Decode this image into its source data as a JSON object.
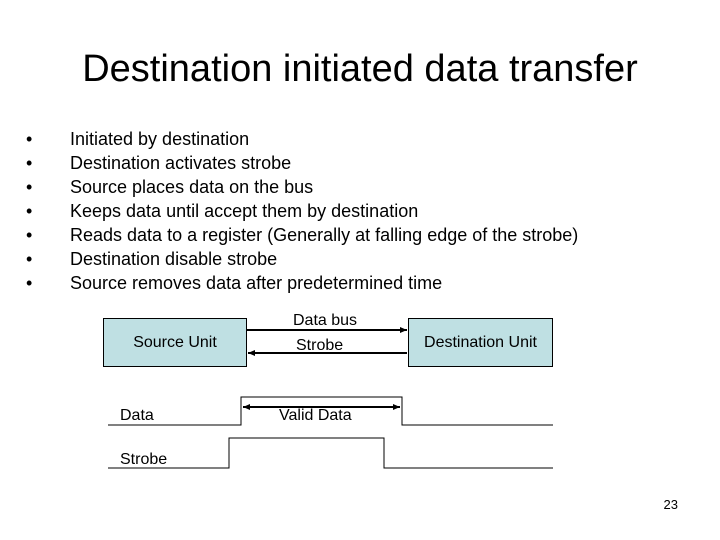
{
  "slide": {
    "title": "Destination initiated data transfer",
    "bullet_glyph": "•",
    "bullets": [
      "Initiated by destination",
      "Destination activates strobe",
      "Source places data on the bus",
      "Keeps data until accept them by destination",
      "Reads data to a register (Generally at falling edge of the strobe)",
      "Destination disable strobe",
      "Source removes data after predetermined time"
    ],
    "page_number": "23"
  },
  "diagram": {
    "source_unit": "Source Unit",
    "destination_unit": "Destination Unit",
    "data_bus_label": "Data bus",
    "strobe_label": "Strobe",
    "box_fill": "#bfe0e3"
  },
  "timing": {
    "data_label": "Data",
    "valid_data_label": "Valid Data",
    "strobe_label": "Strobe"
  }
}
